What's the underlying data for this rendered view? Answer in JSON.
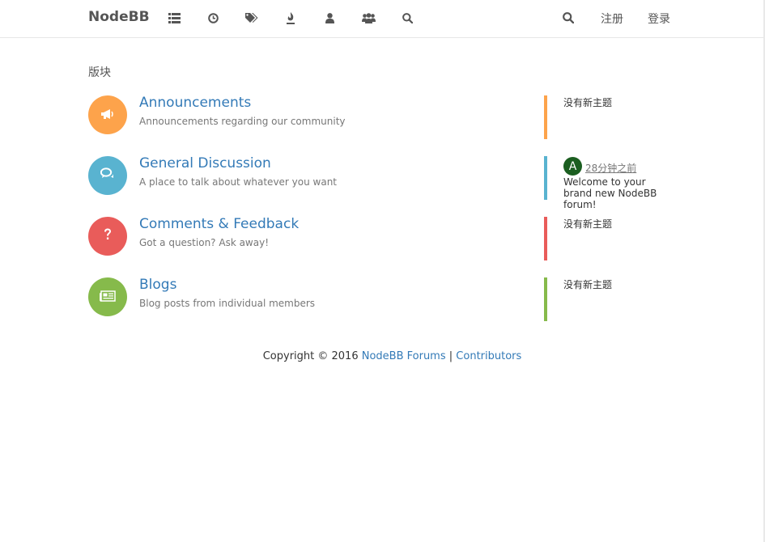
{
  "navbar": {
    "brand": "NodeBB",
    "icons": [
      "list-icon",
      "clock-icon",
      "tags-icon",
      "fire-icon",
      "user-icon",
      "users-icon",
      "search-icon"
    ],
    "right_search_icon": "search-icon",
    "register_label": "注册",
    "login_label": "登录"
  },
  "breadcrumb": "版块",
  "categories": [
    {
      "title": "Announcements",
      "description": "Announcements regarding our community",
      "color": "#fda34b",
      "icon": "bullhorn-icon",
      "teaser": {
        "empty": "没有新主题"
      }
    },
    {
      "title": "General Discussion",
      "description": "A place to talk about whatever you want",
      "color": "#59b3d0",
      "icon": "comments-icon",
      "teaser": {
        "avatar_letter": "A",
        "avatar_color": "#1b5e20",
        "time": "28分钟之前",
        "text": "Welcome to your brand new NodeBB forum!"
      }
    },
    {
      "title": "Comments & Feedback",
      "description": "Got a question? Ask away!",
      "color": "#e95c5a",
      "icon": "question-icon",
      "teaser": {
        "empty": "没有新主题"
      }
    },
    {
      "title": "Blogs",
      "description": "Blog posts from individual members",
      "color": "#86ba4b",
      "icon": "newspaper-icon",
      "teaser": {
        "empty": "没有新主题"
      }
    }
  ],
  "footer": {
    "copyright": "Copyright © 2016",
    "link1": "NodeBB Forums",
    "separator": "|",
    "link2": "Contributors"
  }
}
